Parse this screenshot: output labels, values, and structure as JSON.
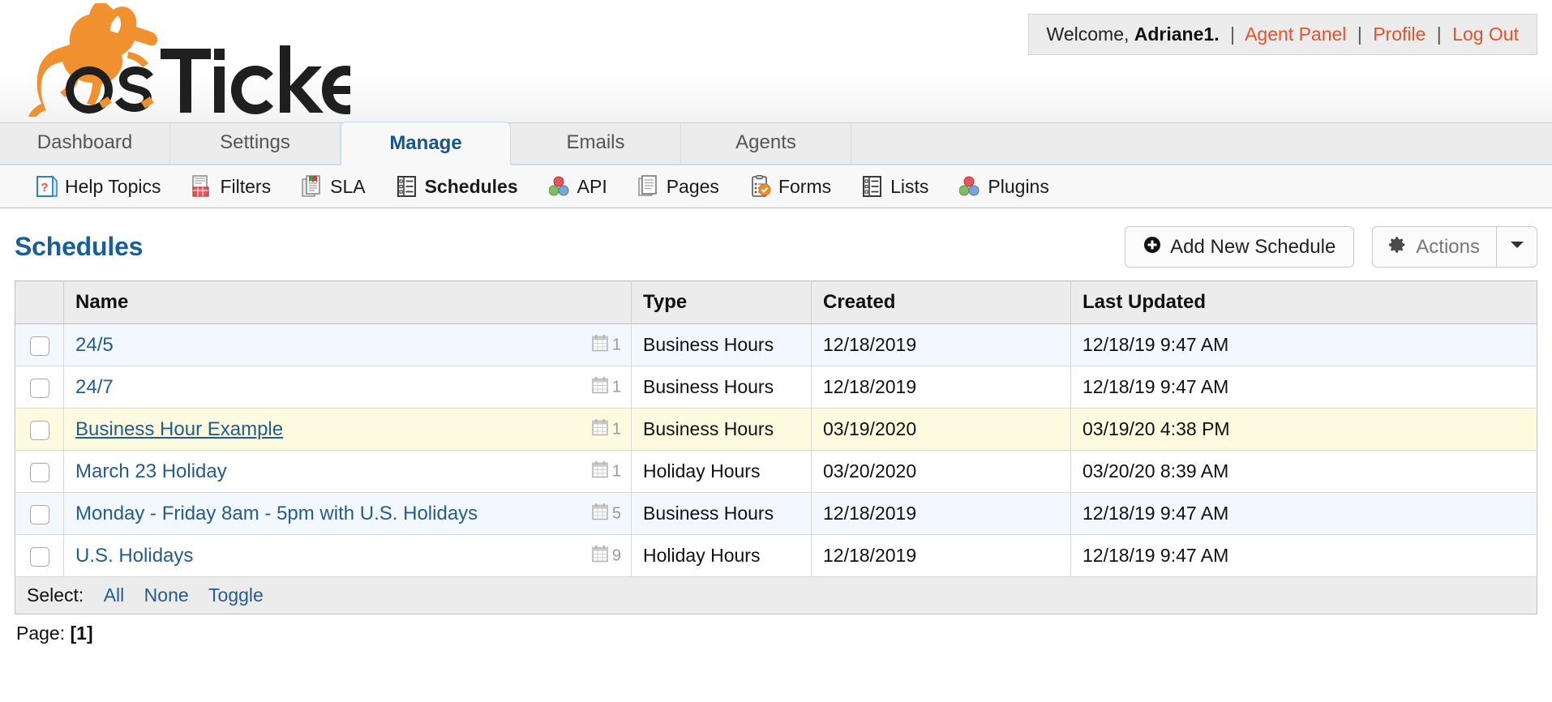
{
  "header": {
    "logo_text": "osTicket",
    "welcome_prefix": "Welcome,",
    "username": "Adriane1.",
    "links": [
      {
        "label": "Agent Panel"
      },
      {
        "label": "Profile"
      },
      {
        "label": "Log Out"
      }
    ],
    "separator": "|"
  },
  "tabs": [
    {
      "label": "Dashboard",
      "active": false
    },
    {
      "label": "Settings",
      "active": false
    },
    {
      "label": "Manage",
      "active": true
    },
    {
      "label": "Emails",
      "active": false
    },
    {
      "label": "Agents",
      "active": false
    }
  ],
  "subnav": [
    {
      "label": "Help Topics",
      "icon": "help-topic-icon",
      "active": false
    },
    {
      "label": "Filters",
      "icon": "filter-icon",
      "active": false
    },
    {
      "label": "SLA",
      "icon": "sla-icon",
      "active": false
    },
    {
      "label": "Schedules",
      "icon": "schedule-icon",
      "active": true
    },
    {
      "label": "API",
      "icon": "api-icon",
      "active": false
    },
    {
      "label": "Pages",
      "icon": "pages-icon",
      "active": false
    },
    {
      "label": "Forms",
      "icon": "forms-icon",
      "active": false
    },
    {
      "label": "Lists",
      "icon": "lists-icon",
      "active": false
    },
    {
      "label": "Plugins",
      "icon": "plugins-icon",
      "active": false
    }
  ],
  "page": {
    "title": "Schedules",
    "add_button": "Add New Schedule",
    "actions_button": "Actions"
  },
  "table": {
    "columns": [
      "Name",
      "Type",
      "Created",
      "Last Updated"
    ],
    "rows": [
      {
        "name": "24/5",
        "count": "1",
        "type": "Business Hours",
        "created": "12/18/2019",
        "updated": "12/18/19 9:47 AM",
        "style": "odd",
        "hover": false
      },
      {
        "name": "24/7",
        "count": "1",
        "type": "Business Hours",
        "created": "12/18/2019",
        "updated": "12/18/19 9:47 AM",
        "style": "even",
        "hover": false
      },
      {
        "name": "Business Hour Example",
        "count": "1",
        "type": "Business Hours",
        "created": "03/19/2020",
        "updated": "03/19/20 4:38 PM",
        "style": "hl",
        "hover": true
      },
      {
        "name": "March 23 Holiday",
        "count": "1",
        "type": "Holiday Hours",
        "created": "03/20/2020",
        "updated": "03/20/20 8:39 AM",
        "style": "even",
        "hover": false
      },
      {
        "name": "Monday - Friday 8am - 5pm with U.S. Holidays",
        "count": "5",
        "type": "Business Hours",
        "created": "12/18/2019",
        "updated": "12/18/19 9:47 AM",
        "style": "odd",
        "hover": false
      },
      {
        "name": "U.S. Holidays",
        "count": "9",
        "type": "Holiday Hours",
        "created": "12/18/2019",
        "updated": "12/18/19 9:47 AM",
        "style": "even",
        "hover": false
      }
    ]
  },
  "footer": {
    "select_label": "Select:",
    "select_links": [
      "All",
      "None",
      "Toggle"
    ],
    "page_label": "Page:",
    "page_value": "[1]"
  },
  "colors": {
    "brand_orange": "#f0902f",
    "link_orange": "#e8512a",
    "title_blue": "#1a5e96",
    "tab_active_blue": "#17558c",
    "row_alt": "#f2f8fd",
    "row_highlight": "#fcfbdf"
  }
}
